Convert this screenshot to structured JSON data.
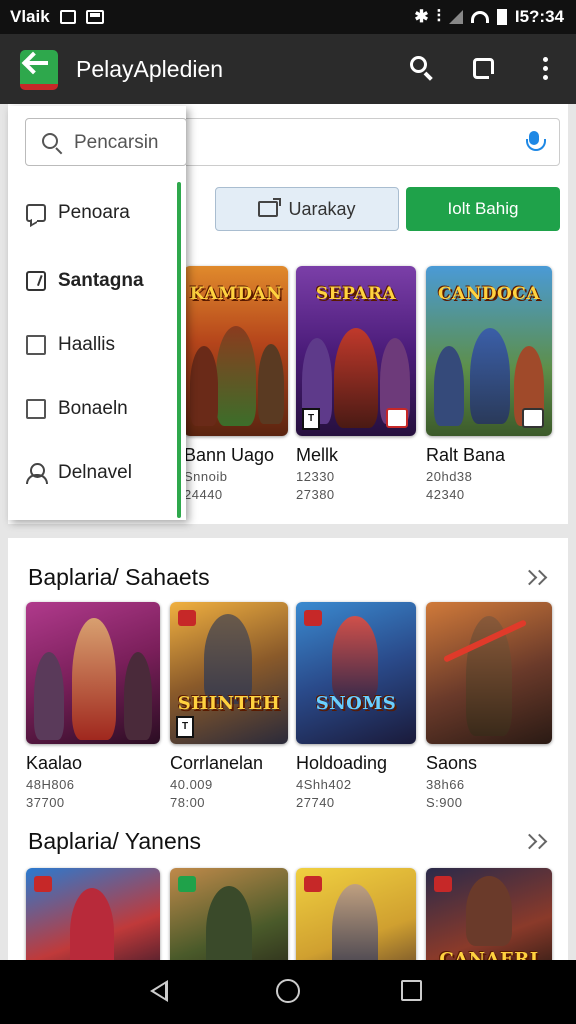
{
  "status_bar": {
    "carrier": "Vlaik",
    "time": "I5?:34"
  },
  "app_bar": {
    "title": "PelayApledien"
  },
  "search": {
    "placeholder": ""
  },
  "drawer": {
    "search_placeholder": "Pencarsin",
    "items": [
      {
        "label": "Penoara",
        "icon": "chat-icon"
      },
      {
        "label": "Santagna",
        "icon": "checkbox-checked-icon"
      },
      {
        "label": "Haallis",
        "icon": "checkbox-icon"
      },
      {
        "label": "Bonaeln",
        "icon": "checkbox-icon"
      },
      {
        "label": "Delnavel",
        "icon": "user-icon"
      }
    ]
  },
  "chips": {
    "secondary_label": "Uarakay",
    "primary_label": "Iolt Bahig"
  },
  "featured": [
    {
      "thumb_title": "KAMDAN",
      "name": "Bann Uago",
      "meta1": "Snnoib",
      "meta2": "24440"
    },
    {
      "thumb_title": "SEPARA",
      "name": "Mellk",
      "meta1": "12330",
      "meta2": "27380"
    },
    {
      "thumb_title": "CANDOCA",
      "name": "Ralt Bana",
      "meta1": "20hd38",
      "meta2": "42340"
    }
  ],
  "section1": {
    "title": "Baplaria/ Sahaets",
    "cards": [
      {
        "thumb_title": "",
        "name": "Kaalao",
        "meta1": "48H806",
        "meta2": "37700"
      },
      {
        "thumb_title": "SHINTEH",
        "name": "Corrlanelan",
        "meta1": "40.009",
        "meta2": "78:00"
      },
      {
        "thumb_title": "SNOMS",
        "name": "Holdoading",
        "meta1": "4Shh402",
        "meta2": "27740"
      },
      {
        "thumb_title": "",
        "name": "Saons",
        "meta1": "38h66",
        "meta2": "S:900"
      }
    ]
  },
  "section2": {
    "title": "Baplaria/ Yanens",
    "cards": [
      {
        "thumb_title": ""
      },
      {
        "thumb_title": ""
      },
      {
        "thumb_title": ""
      },
      {
        "thumb_title": "CANAERI"
      }
    ]
  },
  "colors": {
    "accent_green": "#1fa24a",
    "app_bar": "#2b2b2b",
    "mic_blue": "#1e88e5"
  }
}
